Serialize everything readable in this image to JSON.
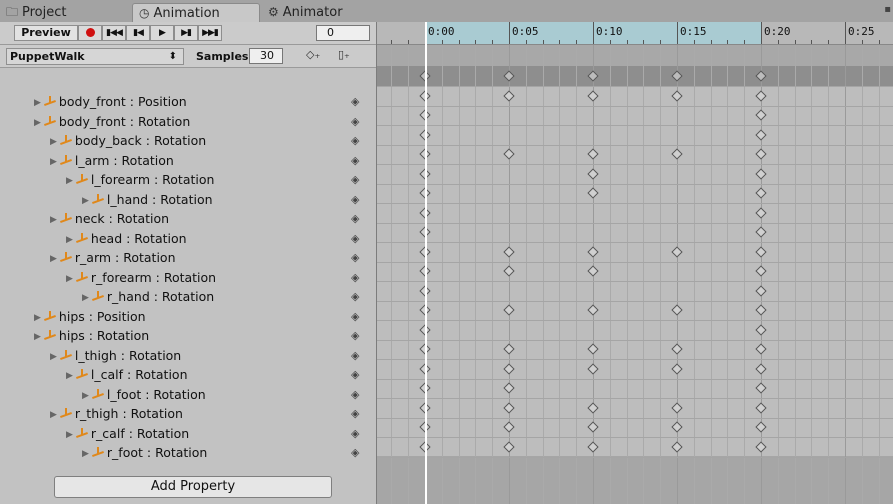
{
  "tabs": [
    {
      "label": "Project",
      "icon": "folder-icon"
    },
    {
      "label": "Animation",
      "icon": "clock-icon"
    },
    {
      "label": "Animator",
      "icon": "animator-icon"
    }
  ],
  "toolbar": {
    "preview_label": "Preview",
    "frame_value": "0"
  },
  "clip": {
    "name": "PuppetWalk",
    "samples_label": "Samples",
    "samples_value": "30"
  },
  "ruler_labels": [
    "0:00",
    "0:05",
    "0:10",
    "0:15",
    "0:20",
    "0:25"
  ],
  "properties": [
    {
      "label": "body_front : Position",
      "indent": 0
    },
    {
      "label": "body_front : Rotation",
      "indent": 0
    },
    {
      "label": "body_back : Rotation",
      "indent": 1
    },
    {
      "label": "l_arm : Rotation",
      "indent": 1
    },
    {
      "label": "l_forearm : Rotation",
      "indent": 2
    },
    {
      "label": "l_hand : Rotation",
      "indent": 3
    },
    {
      "label": "neck : Rotation",
      "indent": 1
    },
    {
      "label": "head : Rotation",
      "indent": 2
    },
    {
      "label": "r_arm : Rotation",
      "indent": 1
    },
    {
      "label": "r_forearm : Rotation",
      "indent": 2
    },
    {
      "label": "r_hand : Rotation",
      "indent": 3
    },
    {
      "label": "hips : Position",
      "indent": 0
    },
    {
      "label": "hips : Rotation",
      "indent": 0
    },
    {
      "label": "l_thigh : Rotation",
      "indent": 1
    },
    {
      "label": "l_calf : Rotation",
      "indent": 2
    },
    {
      "label": "l_foot : Rotation",
      "indent": 3
    },
    {
      "label": "r_thigh : Rotation",
      "indent": 1
    },
    {
      "label": "r_calf : Rotation",
      "indent": 2
    },
    {
      "label": "r_foot : Rotation",
      "indent": 3
    }
  ],
  "keyframes": {
    "summary": [
      0,
      5,
      10,
      15,
      20
    ],
    "rows": [
      [
        0,
        5,
        10,
        15,
        20
      ],
      [
        0,
        20
      ],
      [
        0,
        20
      ],
      [
        0,
        5,
        10,
        15,
        20
      ],
      [
        0,
        10,
        20
      ],
      [
        0,
        10,
        20
      ],
      [
        0,
        20
      ],
      [
        0,
        20
      ],
      [
        0,
        5,
        10,
        15,
        20
      ],
      [
        0,
        5,
        10,
        20
      ],
      [
        0,
        20
      ],
      [
        0,
        5,
        10,
        15,
        20
      ],
      [
        0,
        20
      ],
      [
        0,
        5,
        10,
        15,
        20
      ],
      [
        0,
        5,
        10,
        15,
        20
      ],
      [
        0,
        5,
        20
      ],
      [
        0,
        5,
        10,
        15,
        20
      ],
      [
        0,
        5,
        10,
        15,
        20
      ],
      [
        0,
        5,
        10,
        15,
        20
      ]
    ]
  },
  "add_property_label": "Add Property"
}
